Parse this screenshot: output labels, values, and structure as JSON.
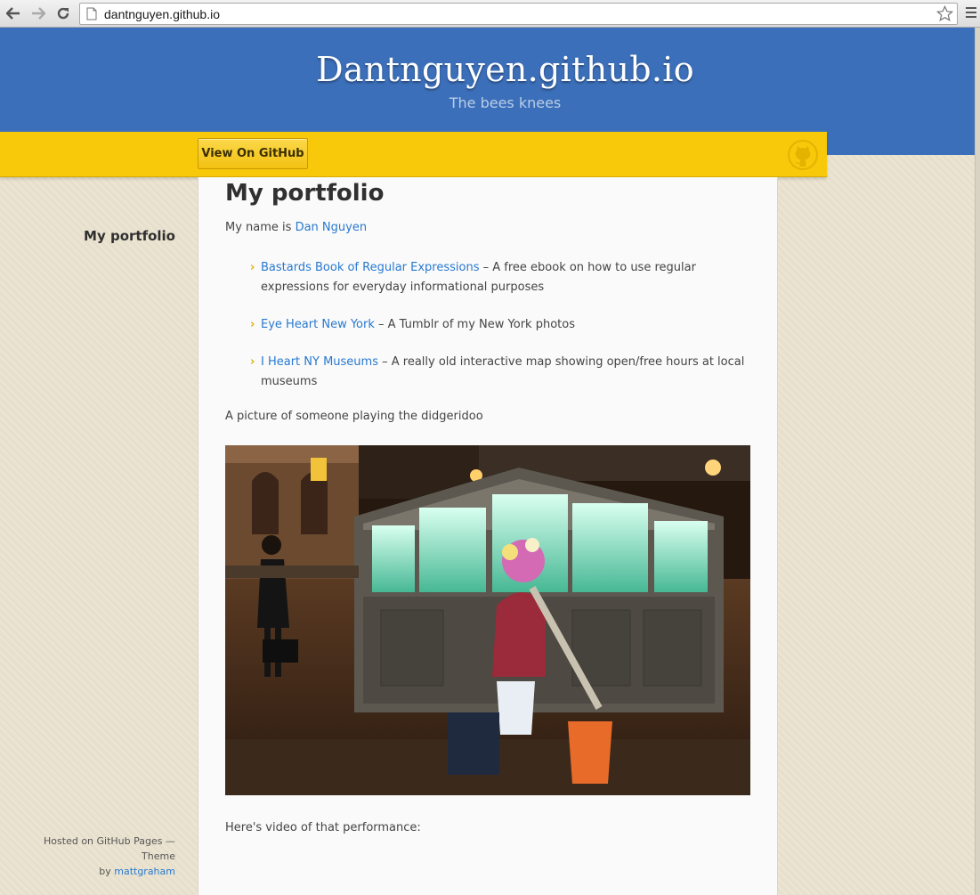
{
  "browser": {
    "url": "dantnguyen.github.io",
    "back_icon": "back-arrow-icon",
    "forward_icon": "forward-arrow-icon",
    "reload_icon": "reload-icon",
    "bookmark_icon": "star-icon",
    "menu_icon": "hamburger-menu-icon"
  },
  "header": {
    "title": "Dantnguyen.github.io",
    "tagline": "The bees knees",
    "github_button": "View On GitHub",
    "header_color": "#3c6fb9",
    "ribbon_color": "#f7c90a"
  },
  "sidebar": {
    "nav_title": "My portfolio",
    "footer": {
      "hosted_text": "Hosted on GitHub Pages — Theme",
      "by_text": "by",
      "theme_author": "mattgraham"
    }
  },
  "main": {
    "title": "My portfolio",
    "intro_text": "My name is",
    "intro_link": "Dan Nguyen",
    "projects": [
      {
        "link": "Bastards Book of Regular Expressions",
        "description": " – A free ebook on how to use regular expressions for everyday informational purposes"
      },
      {
        "link": "Eye Heart New York",
        "description": " – A Tumblr of my New York photos"
      },
      {
        "link": "I Heart NY Museums",
        "description": " – A really old interactive map showing open/free hours at local museums"
      }
    ],
    "picture_caption": "A picture of someone playing the didgeridoo",
    "video_caption": "Here's video of that performance:"
  }
}
